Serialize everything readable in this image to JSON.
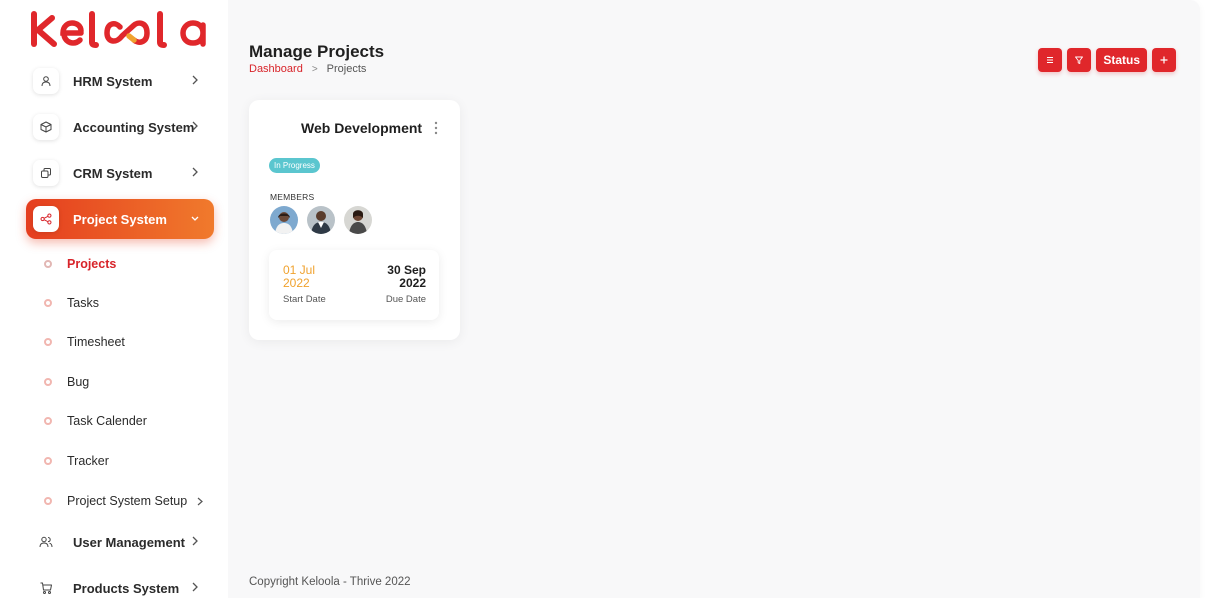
{
  "brand": {
    "logo_text": "KELOOLA",
    "accent": "#e0272b",
    "gradient_start": "#e53e1f",
    "gradient_end": "#f07a2c"
  },
  "sidebar": {
    "items": [
      {
        "label": "HRM System",
        "icon": "user-icon"
      },
      {
        "label": "Accounting System",
        "icon": "box-icon"
      },
      {
        "label": "CRM System",
        "icon": "layers-icon"
      },
      {
        "label": "Project System",
        "icon": "share-icon",
        "active": true
      },
      {
        "label": "User Management",
        "icon": "users-icon"
      },
      {
        "label": "Products System",
        "icon": "cart-icon"
      }
    ],
    "project_sub": [
      {
        "label": "Projects",
        "active": true
      },
      {
        "label": "Tasks"
      },
      {
        "label": "Timesheet"
      },
      {
        "label": "Bug"
      },
      {
        "label": "Task Calender"
      },
      {
        "label": "Tracker"
      },
      {
        "label": "Project System Setup"
      }
    ]
  },
  "header": {
    "title": "Manage Projects",
    "breadcrumb": {
      "home": "Dashboard",
      "current": "Projects"
    },
    "toolbar": {
      "status_label": "Status",
      "list_icon": "list-icon",
      "filter_icon": "filter-icon",
      "add_icon": "plus-icon"
    }
  },
  "project_card": {
    "title": "Web Development",
    "status": "In Progress",
    "status_color": "#5bc6cf",
    "members_label": "MEMBERS",
    "start_date_line1": "01 Jul",
    "start_date_line2": "2022",
    "start_caption": "Start Date",
    "due_date_line1": "30 Sep",
    "due_date_line2": "2022",
    "due_caption": "Due Date"
  },
  "footer": {
    "text": "Copyright Keloola - Thrive 2022"
  }
}
